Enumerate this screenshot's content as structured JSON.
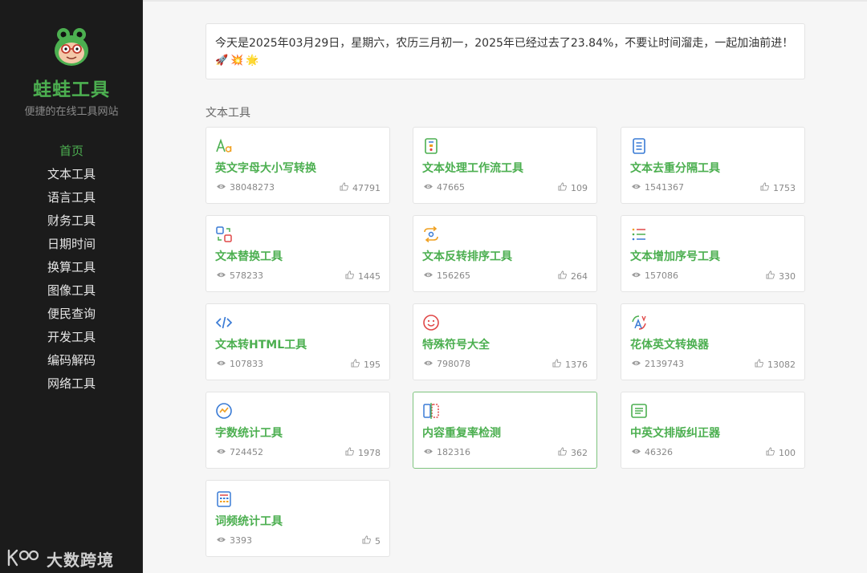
{
  "sidebar": {
    "brand": "蛙蛙工具",
    "slogan": "便捷的在线工具网站",
    "nav": [
      {
        "label": "首页",
        "active": true
      },
      {
        "label": "文本工具"
      },
      {
        "label": "语言工具"
      },
      {
        "label": "财务工具"
      },
      {
        "label": "日期时间"
      },
      {
        "label": "换算工具"
      },
      {
        "label": "图像工具"
      },
      {
        "label": "便民查询"
      },
      {
        "label": "开发工具"
      },
      {
        "label": "编码解码"
      },
      {
        "label": "网络工具"
      }
    ],
    "watermark": "大数跨境",
    "watermark_logo": "k"
  },
  "notice": {
    "text": "今天是2025年03月29日，星期六，农历三月初一，2025年已经过去了23.84%，不要让时间溜走，一起加油前进！",
    "emoji": "🚀💥🌟"
  },
  "section": {
    "title": "文本工具"
  },
  "colors": {
    "accent": "#4caf50",
    "sidebar_bg": "#1b1b1b"
  },
  "tools": [
    {
      "name": "英文字母大小写转换",
      "views": "38048273",
      "likes": "47791",
      "icon": "letter-case-icon"
    },
    {
      "name": "文本处理工作流工具",
      "views": "47665",
      "likes": "109",
      "icon": "workflow-icon"
    },
    {
      "name": "文本去重分隔工具",
      "views": "1541367",
      "likes": "1753",
      "icon": "document-lines-icon"
    },
    {
      "name": "文本替换工具",
      "views": "578233",
      "likes": "1445",
      "icon": "replace-icon"
    },
    {
      "name": "文本反转排序工具",
      "views": "156265",
      "likes": "264",
      "icon": "reverse-icon"
    },
    {
      "name": "文本增加序号工具",
      "views": "157086",
      "likes": "330",
      "icon": "numbered-list-icon"
    },
    {
      "name": "文本转HTML工具",
      "views": "107833",
      "likes": "195",
      "icon": "code-icon"
    },
    {
      "name": "特殊符号大全",
      "views": "798078",
      "likes": "1376",
      "icon": "smiley-icon"
    },
    {
      "name": "花体英文转换器",
      "views": "2139743",
      "likes": "13082",
      "icon": "fancy-letter-icon"
    },
    {
      "name": "字数统计工具",
      "views": "724452",
      "likes": "1978",
      "icon": "chart-circle-icon"
    },
    {
      "name": "内容重复率检测",
      "views": "182316",
      "likes": "362",
      "icon": "compare-icon",
      "highlight": true
    },
    {
      "name": "中英文排版纠正器",
      "views": "46326",
      "likes": "100",
      "icon": "typeset-icon"
    },
    {
      "name": "词频统计工具",
      "views": "3393",
      "likes": "5",
      "icon": "calculator-icon"
    }
  ]
}
